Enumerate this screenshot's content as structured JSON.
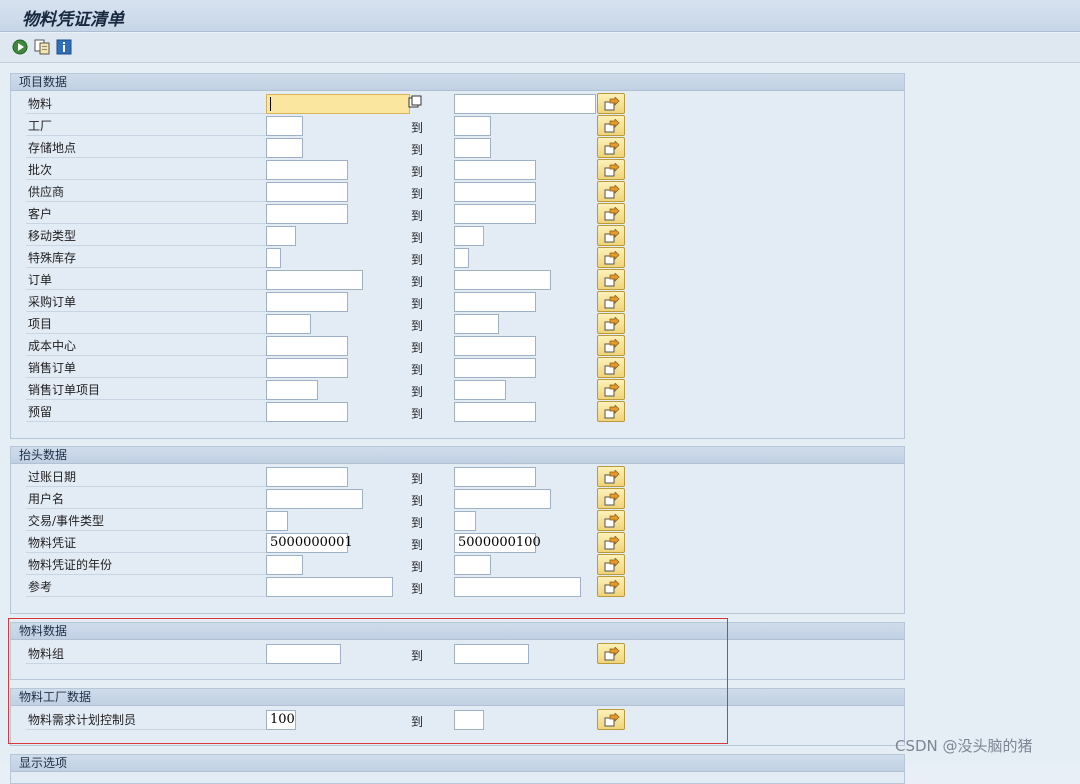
{
  "window": {
    "title": "物料凭证清单"
  },
  "toolbar": {
    "icons": [
      "execute-icon",
      "variant-icon",
      "info-icon"
    ]
  },
  "groups": {
    "item_data": {
      "title": "项目数据",
      "rows": [
        {
          "label": "物料",
          "to": "",
          "from_value": "",
          "to_value": ""
        },
        {
          "label": "工厂",
          "to": "到",
          "from_value": "",
          "to_value": ""
        },
        {
          "label": "存储地点",
          "to": "到",
          "from_value": "",
          "to_value": ""
        },
        {
          "label": "批次",
          "to": "到",
          "from_value": "",
          "to_value": ""
        },
        {
          "label": "供应商",
          "to": "到",
          "from_value": "",
          "to_value": ""
        },
        {
          "label": "客户",
          "to": "到",
          "from_value": "",
          "to_value": ""
        },
        {
          "label": "移动类型",
          "to": "到",
          "from_value": "",
          "to_value": ""
        },
        {
          "label": "特殊库存",
          "to": "到",
          "from_value": "",
          "to_value": ""
        },
        {
          "label": "订单",
          "to": "到",
          "from_value": "",
          "to_value": ""
        },
        {
          "label": "采购订单",
          "to": "到",
          "from_value": "",
          "to_value": ""
        },
        {
          "label": "项目",
          "to": "到",
          "from_value": "",
          "to_value": ""
        },
        {
          "label": "成本中心",
          "to": "到",
          "from_value": "",
          "to_value": ""
        },
        {
          "label": "销售订单",
          "to": "到",
          "from_value": "",
          "to_value": ""
        },
        {
          "label": "销售订单项目",
          "to": "到",
          "from_value": "",
          "to_value": ""
        },
        {
          "label": "预留",
          "to": "到",
          "from_value": "",
          "to_value": ""
        }
      ]
    },
    "header_data": {
      "title": "抬头数据",
      "rows": [
        {
          "label": "过账日期",
          "to": "到",
          "from_value": "",
          "to_value": ""
        },
        {
          "label": "用户名",
          "to": "到",
          "from_value": "",
          "to_value": ""
        },
        {
          "label": "交易/事件类型",
          "to": "到",
          "from_value": "",
          "to_value": ""
        },
        {
          "label": "物料凭证",
          "to": "到",
          "from_value": "5000000001",
          "to_value": "5000000100"
        },
        {
          "label": "物料凭证的年份",
          "to": "到",
          "from_value": "",
          "to_value": ""
        },
        {
          "label": "参考",
          "to": "到",
          "from_value": "",
          "to_value": ""
        }
      ]
    },
    "material_data": {
      "title": "物料数据",
      "rows": [
        {
          "label": "物料组",
          "to": "到",
          "from_value": "",
          "to_value": ""
        }
      ]
    },
    "plant_data": {
      "title": "物料工厂数据",
      "rows": [
        {
          "label": "物料需求计划控制员",
          "to": "到",
          "from_value": "100",
          "to_value": ""
        }
      ]
    },
    "display_options": {
      "title": "显示选项"
    }
  },
  "watermark": "CSDN @没头脑的猪",
  "colors": {
    "accent_focus": "#fbe6a0",
    "highlight_box": "#d9363e",
    "button_yellow": "#f0d479"
  }
}
